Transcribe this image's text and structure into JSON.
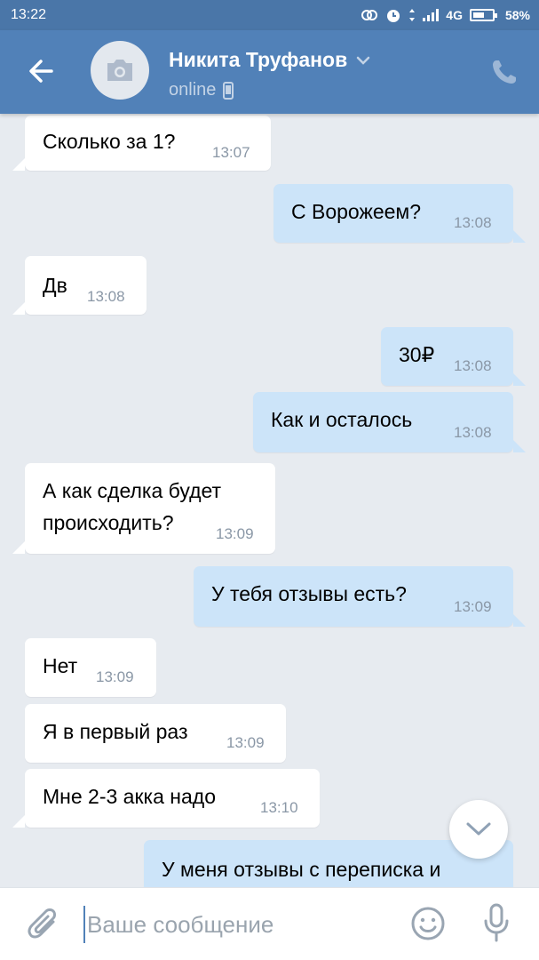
{
  "status_bar": {
    "time": "13:22",
    "network": "4G",
    "battery_percent": "58%",
    "battery_level": 0.58
  },
  "header": {
    "contact_name": "Никита Труфанов",
    "status": "online",
    "icons": {
      "back": "arrow-left-icon",
      "avatar": "camera-icon",
      "dropdown": "chevron-down-icon",
      "device": "mobile-phone-icon",
      "call": "phone-icon"
    }
  },
  "messages": [
    {
      "direction": "in",
      "text": "Сколько за 1?",
      "time": "13:07"
    },
    {
      "direction": "out",
      "text": "С Ворожеем?",
      "time": "13:08"
    },
    {
      "direction": "in",
      "text": "Дв",
      "time": "13:08"
    },
    {
      "direction": "out",
      "text": "30₽",
      "time": "13:08"
    },
    {
      "direction": "out",
      "text": "Как и осталось",
      "time": "13:08"
    },
    {
      "direction": "in",
      "text_line1": "А как сделка будет",
      "text_line2": "происходить?",
      "time": "13:09"
    },
    {
      "direction": "out",
      "text": "У тебя отзывы есть?",
      "time": "13:09"
    },
    {
      "direction": "in",
      "text": "Нет",
      "time": "13:09"
    },
    {
      "direction": "in",
      "text": "Я в первый раз",
      "time": "13:09"
    },
    {
      "direction": "in",
      "text": "Мне 2-3 акка надо",
      "time": "13:10"
    },
    {
      "direction": "out",
      "text": "У меня отзывы с переписка и",
      "time": ""
    }
  ],
  "composer": {
    "placeholder": "Ваше сообщение",
    "value": ""
  },
  "colors": {
    "header": "#5181b8",
    "status_bar": "#4a76a8",
    "background": "#e7ebf0",
    "incoming_bubble": "#ffffff",
    "outgoing_bubble": "#cce4f9",
    "time_text": "#8a97a6"
  }
}
